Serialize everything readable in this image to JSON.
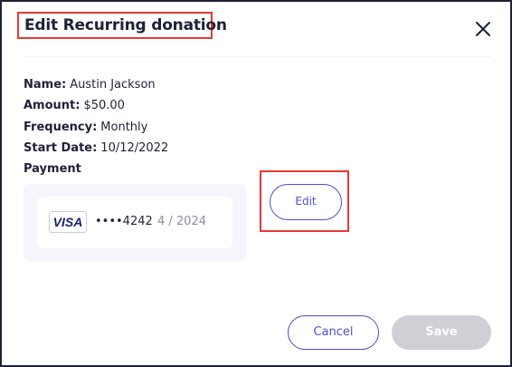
{
  "dialog": {
    "title": "Edit Recurring donation"
  },
  "details": {
    "name_label": "Name:",
    "name_value": "Austin Jackson",
    "amount_label": "Amount:",
    "amount_value": "$50.00",
    "frequency_label": "Frequency:",
    "frequency_value": "Monthly",
    "start_label": "Start Date:",
    "start_value": "10/12/2022",
    "payment_label": "Payment"
  },
  "card": {
    "brand": "VISA",
    "number": "••••4242",
    "expiry": "4 / 2024"
  },
  "actions": {
    "edit_label": "Edit",
    "cancel_label": "Cancel",
    "save_label": "Save"
  },
  "colors": {
    "accent": "#4b4fc7",
    "highlight": "#e53935",
    "disabled": "#cfd0d6",
    "text": "#1f2137"
  },
  "icons": {
    "close": "close-icon"
  }
}
